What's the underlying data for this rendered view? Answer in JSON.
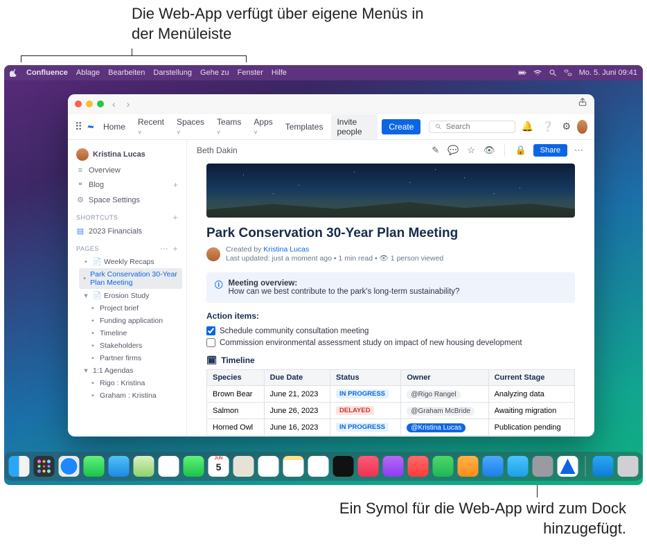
{
  "callouts": {
    "top": "Die Web-App verfügt über eigene Menüs in der Menüleiste",
    "bottom": "Ein Symol für die Web-App wird zum Dock hinzugefügt."
  },
  "menubar": {
    "app": "Confluence",
    "items": [
      "Ablage",
      "Bearbeiten",
      "Darstellung",
      "Gehe zu",
      "Fenster",
      "Hilfe"
    ],
    "clock": "Mo. 5. Juni  09:41"
  },
  "chrome": {
    "home": "Home",
    "recent": "Recent",
    "spaces": "Spaces",
    "teams": "Teams",
    "apps": "Apps",
    "templates": "Templates",
    "invite": "Invite people",
    "create": "Create",
    "search_placeholder": "Search"
  },
  "sidebar": {
    "user": "Kristina Lucas",
    "overview": "Overview",
    "blog": "Blog",
    "space_settings": "Space Settings",
    "shortcuts_label": "SHORTCUTS",
    "shortcut1": "2023 Financials",
    "pages_label": "Pages",
    "tree": {
      "weekly": "Weekly Recaps",
      "park": "Park Conservation 30-Year Plan Meeting",
      "erosion": "Erosion Study",
      "children": [
        "Project brief",
        "Funding application",
        "Timeline",
        "Stakeholders",
        "Partner firms"
      ],
      "agendas": "1:1 Agendas",
      "agchildren": [
        "Rigo : Kristina",
        "Graham : Kristina"
      ]
    }
  },
  "page": {
    "breadcrumb_author": "Beth Dakin",
    "share": "Share",
    "title": "Park Conservation 30-Year Plan Meeting",
    "created_by_label": "Created by",
    "created_by": "Kristina Lucas",
    "meta": "Last updated: just a moment ago  •  1 min read  •  👁 1 person viewed",
    "panel_title": "Meeting overview:",
    "panel_body": "How can we best contribute to the park's long-term sustainability?",
    "action_items": "Action items:",
    "check1": "Schedule community consultation meeting",
    "check2": "Commission environmental assessment study on impact of new housing development",
    "timeline": "Timeline",
    "table": {
      "headers": [
        "Species",
        "Due Date",
        "Status",
        "Owner",
        "Current Stage"
      ],
      "rows": [
        {
          "sp": "Brown Bear",
          "due": "June 21, 2023",
          "status": "IN PROGRESS",
          "status_cls": "prog",
          "owner": "@Rigo Rangel",
          "owner_cls": "",
          "stage": "Analyzing data"
        },
        {
          "sp": "Salmon",
          "due": "June 26, 2023",
          "status": "DELAYED",
          "status_cls": "del",
          "owner": "@Graham McBride",
          "owner_cls": "",
          "stage": "Awaiting migration"
        },
        {
          "sp": "Horned Owl",
          "due": "June 16, 2023",
          "status": "IN PROGRESS",
          "status_cls": "prog",
          "owner": "@Kristina Lucas",
          "owner_cls": "me",
          "stage": "Publication pending"
        }
      ]
    }
  }
}
